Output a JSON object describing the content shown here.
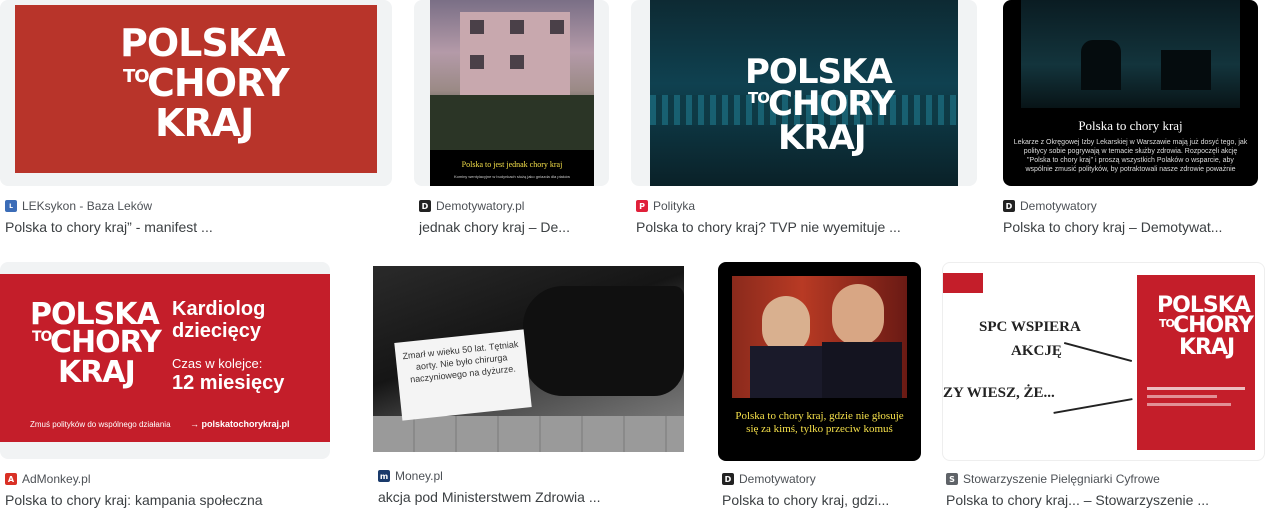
{
  "results": [
    {
      "source": "LEKsykon - Baza Leków",
      "favicon": "LEK",
      "favicon_color": "#3b6cb7",
      "title": "Polska to chory kraj” - manifest ..."
    },
    {
      "source": "Demotywatory.pl",
      "favicon": "D",
      "favicon_color": "#222222",
      "title": "jednak chory kraj – De...",
      "caption": "Polska to jest jednak chory kraj",
      "subcaption": "Kominy wentylacyjne w budynkach służą jako gniazda dla ptaków"
    },
    {
      "source": "Polityka",
      "favicon": "P",
      "favicon_color": "#e0203a",
      "title": "Polska to chory kraj? TVP nie wyemituje ..."
    },
    {
      "source": "Demotywatory",
      "favicon": "D",
      "favicon_color": "#222222",
      "title": "Polska to chory kraj – Demotywat...",
      "caption": "Polska to chory kraj",
      "subcaption": "Lekarze z Okręgowej Izby Lekarskiej w Warszawie mają już dosyć tego, jak politycy sobie pogrywają w temacie służby zdrowia. Rozpoczęli akcję \"Polska to chory kraj\" i proszą wszystkich Polaków o wsparcie, aby wspólnie zmusić polityków, by potraktowali nasze zdrowie poważnie"
    },
    {
      "source": "AdMonkey.pl",
      "favicon": "A",
      "favicon_color": "#d93025",
      "title": "Polska to chory kraj: kampania społeczna",
      "heading": "Kardiolog dziecięcy",
      "wait_label": "Czas w kolejce:",
      "wait_value": "12 miesięcy",
      "footer": "Zmuś polityków do wspólnego działania",
      "url": "→ polskatochorykraj.pl"
    },
    {
      "source": "Money.pl",
      "favicon": "m",
      "favicon_color": "#1a3a6b",
      "title": "akcja pod Ministerstwem Zdrowia ...",
      "sign": "Zmarł w wieku 50 lat. Tętniak aorty. Nie było chirurga naczyniowego na dyżurze."
    },
    {
      "source": "Demotywatory",
      "favicon": "D",
      "favicon_color": "#222222",
      "title": "Polska to chory kraj, gdzi...",
      "caption": "Polska to chory kraj, gdzie nie głosuje się za kimś, tylko przeciw komuś"
    },
    {
      "source": "Stowarzyszenie Pielęgniarki Cyfrowe",
      "favicon": "S",
      "favicon_color": "#5f6368",
      "title": "Polska to chory kraj... – Stowarzyszenie ...",
      "line1": "SPC WSPIERA",
      "line2": "AKCJĘ",
      "line3": "ZY WIESZ, ŻE..."
    }
  ],
  "graffiti": {
    "word1": "Polska",
    "word2": "to",
    "word3": "chory",
    "word4": "kraj"
  },
  "colors": {
    "campaign_red": "#b8342a",
    "banner_red": "#c41e2a"
  }
}
